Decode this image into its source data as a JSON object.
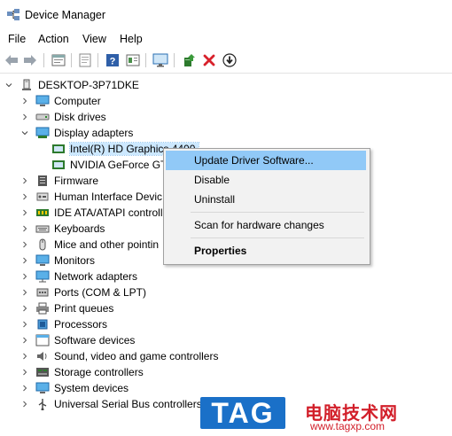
{
  "window": {
    "title": "Device Manager"
  },
  "menu": [
    "File",
    "Action",
    "View",
    "Help"
  ],
  "toolbar": [
    "back-icon",
    "forward-icon",
    "properties-icon",
    "hidden-devices-icon",
    "help-icon",
    "view-icon",
    "monitor-icon",
    "update-driver-icon",
    "uninstall-icon",
    "download-icon"
  ],
  "tree": {
    "root": "DESKTOP-3P71DKE",
    "items": [
      {
        "label": "Computer",
        "state": "collapsed",
        "icon": "computer-icon"
      },
      {
        "label": "Disk drives",
        "state": "collapsed",
        "icon": "disk-drive-icon"
      },
      {
        "label": "Display adapters",
        "state": "expanded",
        "icon": "display-adapter-icon"
      },
      {
        "label": "Intel(R) HD Graphics 4400",
        "child": true,
        "selected": true,
        "icon": "gpu-icon"
      },
      {
        "label": "NVIDIA GeForce GT",
        "child": true,
        "icon": "gpu-icon"
      },
      {
        "label": "Firmware",
        "state": "collapsed",
        "icon": "firmware-icon"
      },
      {
        "label": "Human Interface Devic",
        "state": "collapsed",
        "icon": "hid-icon"
      },
      {
        "label": "IDE ATA/ATAPI controll",
        "state": "collapsed",
        "icon": "ide-icon"
      },
      {
        "label": "Keyboards",
        "state": "collapsed",
        "icon": "keyboard-icon"
      },
      {
        "label": "Mice and other pointin",
        "state": "collapsed",
        "icon": "mouse-icon"
      },
      {
        "label": "Monitors",
        "state": "collapsed",
        "icon": "monitor-icon"
      },
      {
        "label": "Network adapters",
        "state": "collapsed",
        "icon": "network-icon"
      },
      {
        "label": "Ports (COM & LPT)",
        "state": "collapsed",
        "icon": "port-icon"
      },
      {
        "label": "Print queues",
        "state": "collapsed",
        "icon": "printer-icon"
      },
      {
        "label": "Processors",
        "state": "collapsed",
        "icon": "processor-icon"
      },
      {
        "label": "Software devices",
        "state": "collapsed",
        "icon": "software-device-icon"
      },
      {
        "label": "Sound, video and game controllers",
        "state": "collapsed",
        "icon": "sound-icon"
      },
      {
        "label": "Storage controllers",
        "state": "collapsed",
        "icon": "storage-icon"
      },
      {
        "label": "System devices",
        "state": "collapsed",
        "icon": "system-device-icon"
      },
      {
        "label": "Universal Serial Bus controllers",
        "state": "collapsed",
        "icon": "usb-icon"
      }
    ]
  },
  "context_menu": {
    "items": [
      {
        "label": "Update Driver Software...",
        "highlighted": true
      },
      {
        "label": "Disable"
      },
      {
        "label": "Uninstall"
      },
      {
        "label": "Scan for hardware changes"
      },
      {
        "label": "Properties",
        "bold": true
      }
    ]
  },
  "watermark": {
    "tag": "TAG",
    "cn": "电脑技术网",
    "url": "www.tagxp.com"
  },
  "colors": {
    "selection": "#cce8ff",
    "menu_highlight": "#91c9f7",
    "watermark_blue": "#1a70c8",
    "watermark_red": "#d21f2a"
  }
}
